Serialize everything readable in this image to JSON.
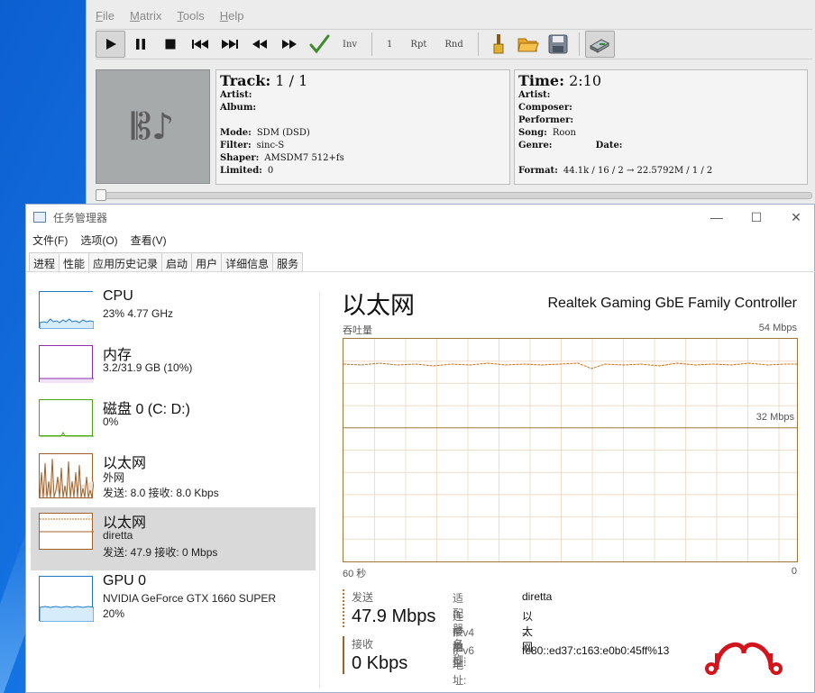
{
  "player": {
    "menu": [
      {
        "label": "File",
        "accel": "F"
      },
      {
        "label": "Matrix",
        "accel": "M"
      },
      {
        "label": "Tools",
        "accel": "T"
      },
      {
        "label": "Help",
        "accel": "H"
      }
    ],
    "toolbar": {
      "inv_label": "Inv",
      "count_label": "1",
      "rpt_label": "Rpt",
      "rnd_label": "Rnd"
    },
    "track": {
      "track_label": "Track:",
      "track_value": "1 / 1",
      "artist_label": "Artist:",
      "artist_value": "",
      "album_label": "Album:",
      "album_value": "",
      "mode_label": "Mode:",
      "mode_value": "SDM (DSD)",
      "filter_label": "Filter:",
      "filter_value": "sinc-S",
      "shaper_label": "Shaper:",
      "shaper_value": "AMSDM7 512+fs",
      "limited_label": "Limited:",
      "limited_value": "0"
    },
    "time": {
      "time_label": "Time:",
      "time_value": "2:10",
      "artist_label": "Artist:",
      "composer_label": "Composer:",
      "performer_label": "Performer:",
      "song_label": "Song:",
      "song_value": "Roon",
      "genre_label": "Genre:",
      "date_label": "Date:",
      "format_label": "Format:",
      "format_value": "44.1k / 16 / 2 → 22.5792M / 1 / 2"
    }
  },
  "taskmgr": {
    "title": "任务管理器",
    "menu": [
      "文件(F)",
      "选项(O)",
      "查看(V)"
    ],
    "tabs": [
      "进程",
      "性能",
      "应用历史记录",
      "启动",
      "用户",
      "详细信息",
      "服务"
    ],
    "selected_tab": "性能",
    "perf_items": [
      {
        "title": "CPU",
        "sub": "23% 4.77 GHz",
        "sub2": "",
        "color": "#1e7ac4"
      },
      {
        "title": "内存",
        "sub": "3.2/31.9 GB (10%)",
        "sub2": "",
        "color": "#8b2fa8"
      },
      {
        "title": "磁盘 0 (C: D:)",
        "sub": "0%",
        "sub2": "",
        "color": "#4da60c"
      },
      {
        "title": "以太网",
        "sub": "外网",
        "sub2": "发送: 8.0 接收: 8.0 Kbps",
        "color": "#a0602a"
      },
      {
        "title": "以太网",
        "sub": "diretta",
        "sub2": "发送: 47.9 接收: 0 Mbps",
        "color": "#a0602a"
      },
      {
        "title": "GPU 0",
        "sub": "NVIDIA GeForce GTX 1660 SUPER",
        "sub2": "20%",
        "color": "#1e7ac4"
      }
    ],
    "detail": {
      "title": "以太网",
      "device": "Realtek Gaming GbE Family Controller",
      "graph_label": "吞吐量",
      "graph_max": "54 Mbps",
      "graph_mid": "32 Mbps",
      "x_left": "60 秒",
      "x_right": "0",
      "send_label": "发送",
      "send_value": "47.9 Mbps",
      "recv_label": "接收",
      "recv_value": "0 Kbps",
      "props": [
        {
          "k": "适配器名称:",
          "v": "diretta"
        },
        {
          "k": "连接类型:",
          "v": "以太网"
        },
        {
          "k": "IPv4 地址:",
          "v": "-"
        },
        {
          "k": "IPv6 地址:",
          "v": "fe80::ed37:c163:e0b0:45ff%13"
        }
      ]
    }
  }
}
